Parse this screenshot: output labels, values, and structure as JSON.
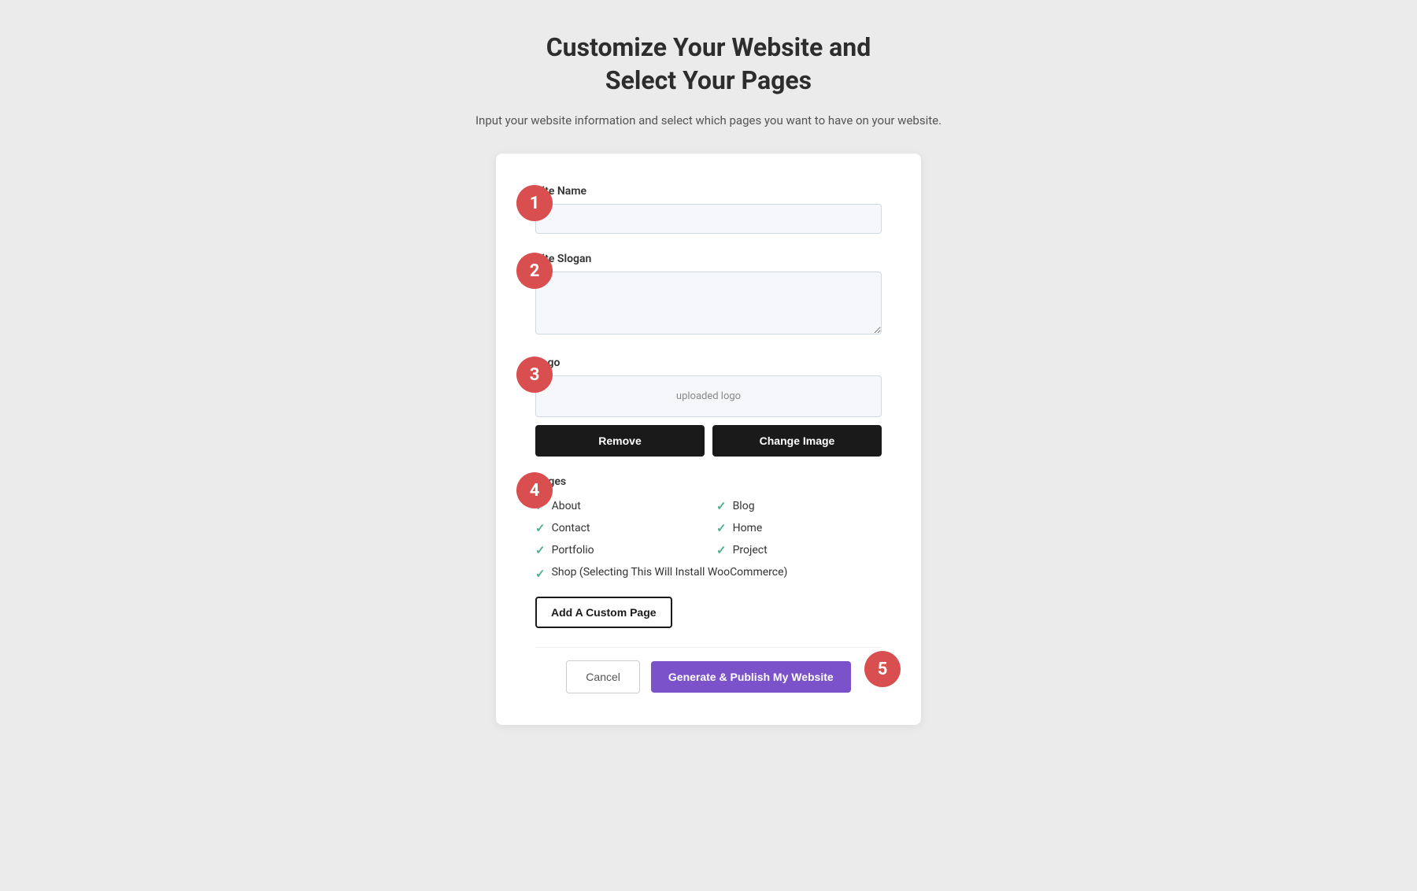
{
  "header": {
    "title_line1": "Customize Your Website and",
    "title_line2": "Select Your Pages",
    "subtitle": "Input your website information and select which pages you want to have on your website."
  },
  "steps": {
    "step1": "1",
    "step2": "2",
    "step3": "3",
    "step4": "4",
    "step5": "5"
  },
  "form": {
    "site_name_label": "Site Name",
    "site_name_placeholder": "",
    "site_slogan_label": "Site Slogan",
    "site_slogan_placeholder": "",
    "logo_label": "Logo",
    "logo_preview_text": "uploaded logo",
    "remove_button": "Remove",
    "change_image_button": "Change Image",
    "pages_label": "Pages",
    "pages": [
      {
        "name": "About",
        "checked": true
      },
      {
        "name": "Blog",
        "checked": true
      },
      {
        "name": "Contact",
        "checked": true
      },
      {
        "name": "Home",
        "checked": true
      },
      {
        "name": "Portfolio",
        "checked": true
      },
      {
        "name": "Project",
        "checked": true
      }
    ],
    "shop_page": {
      "name": "Shop (Selecting This Will Install WooCommerce)",
      "checked": true
    },
    "add_custom_page_button": "Add A Custom Page",
    "cancel_button": "Cancel",
    "publish_button": "Generate & Publish My Website"
  }
}
